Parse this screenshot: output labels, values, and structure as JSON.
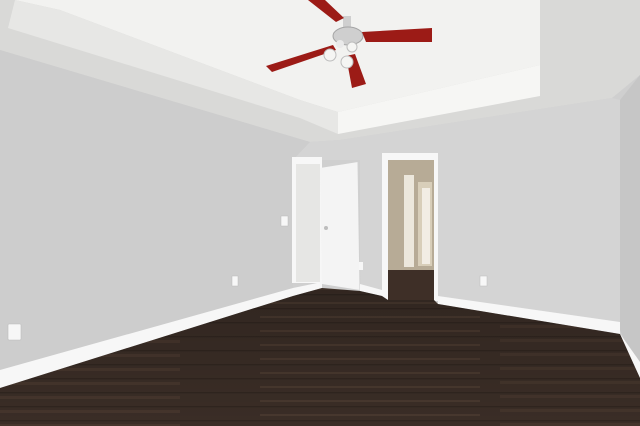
{
  "scene": {
    "subject": "empty bedroom",
    "colors": {
      "ceiling": "#ececea",
      "ceiling_texture": "#d9d9d7",
      "tray_ceiling": "#f2f2f0",
      "left_wall": "#cdcdcd",
      "back_wall": "#d4d4d4",
      "right_wall": "#c6c6c6",
      "trim": "#f7f7f7",
      "floor_dark": "#3a2d26",
      "floor_light": "#5a463b",
      "door": "#f4f4f4",
      "hallway": "#b7ab96",
      "fan_blade": "#9c1b16",
      "fan_metal": "#cfcfcf"
    },
    "objects": [
      {
        "name": "ceiling-fan",
        "icon": "fan-icon"
      },
      {
        "name": "open-door",
        "icon": "door-icon"
      },
      {
        "name": "hallway-doorway",
        "icon": "doorway-icon"
      },
      {
        "name": "wall-outlet",
        "icon": "outlet-icon"
      },
      {
        "name": "light-switch",
        "icon": "switch-icon"
      }
    ]
  }
}
